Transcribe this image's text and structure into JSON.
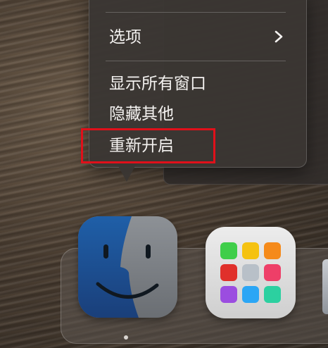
{
  "menu": {
    "items": [
      {
        "label": "选项",
        "submenu": true
      },
      {
        "label": "显示所有窗口"
      },
      {
        "label": "隐藏其他"
      },
      {
        "label": "重新开启",
        "highlighted": true
      }
    ],
    "highlight_color": "#e0101a"
  },
  "dock": {
    "apps": [
      {
        "name": "Finder",
        "icon": "finder-icon"
      },
      {
        "name": "Launchpad",
        "icon": "launchpad-icon"
      }
    ],
    "running_indicator": "Finder",
    "launchpad_tile_colors": [
      "#3fce4a",
      "#f5c211",
      "#f58a1a",
      "#e0302b",
      "#b8c0c8",
      "#ee3f68",
      "#9b4de0",
      "#2ba6f5",
      "#2cd0a0"
    ]
  }
}
